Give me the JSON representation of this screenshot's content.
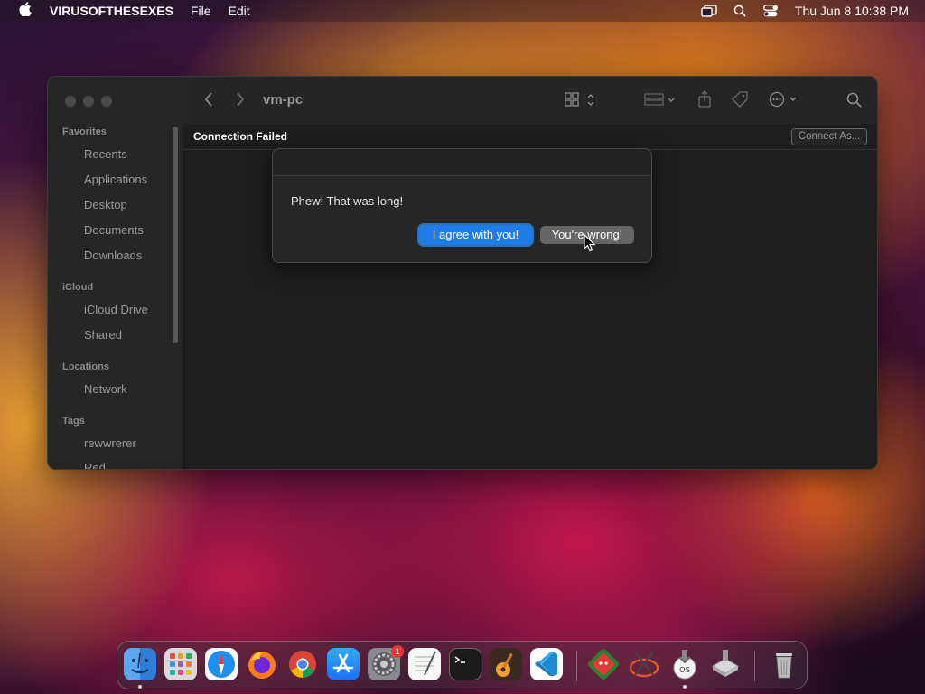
{
  "menubar": {
    "app_name": "VIRUSOFTHESEXES",
    "items": [
      "File",
      "Edit"
    ],
    "clock": "Thu Jun 8  10:38 PM"
  },
  "window": {
    "title": "vm-pc",
    "sidebar": {
      "favorites_header": "Favorites",
      "favorites": [
        "Recents",
        "Applications",
        "Desktop",
        "Documents",
        "Downloads"
      ],
      "icloud_header": "iCloud",
      "icloud": [
        "iCloud Drive",
        "Shared"
      ],
      "locations_header": "Locations",
      "locations": [
        "Network"
      ],
      "tags_header": "Tags",
      "tags": [
        "rewwrerer",
        "Red"
      ]
    },
    "status": {
      "message": "Connection Failed",
      "connect_button": "Connect As..."
    }
  },
  "dialog": {
    "message": "Phew! That was long!",
    "primary_button": "I agree with you!",
    "secondary_button": "You're wrong!"
  },
  "dock": {
    "apps": [
      "finder-icon",
      "launchpad-icon",
      "safari-icon",
      "firefox-icon",
      "chrome-icon",
      "app-store-icon",
      "system-settings-icon",
      "textedit-icon",
      "terminal-icon",
      "garageband-icon",
      "vscode-icon",
      "game-app-icon",
      "network-tool-icon",
      "macos-installer-icon",
      "disk-utility-icon",
      "trash-icon"
    ],
    "settings_badge": "1"
  }
}
